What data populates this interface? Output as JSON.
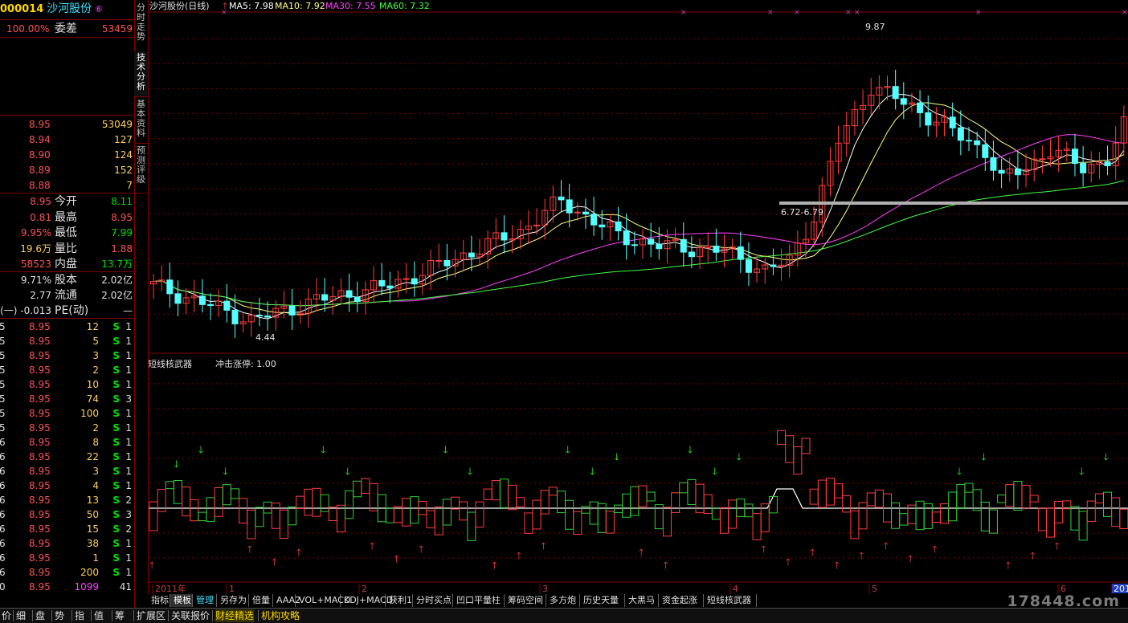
{
  "stock": {
    "code": "000014",
    "name": "沙河股份",
    "badge": "⑥"
  },
  "weibi": {
    "pct": "100.00%",
    "label": "委差",
    "value": "53459"
  },
  "sell_orders": [
    {
      "price": "8.95",
      "vol": "53049"
    },
    {
      "price": "8.94",
      "vol": "127"
    },
    {
      "price": "8.90",
      "vol": "124"
    },
    {
      "price": "8.89",
      "vol": "152"
    },
    {
      "price": "8.88",
      "vol": "7"
    }
  ],
  "quote_rows": [
    {
      "v1": "8.95",
      "label": "今开",
      "v2": "8.11"
    },
    {
      "v1": "0.81",
      "label": "最高",
      "v2": "8.95"
    },
    {
      "v1": "9.95%",
      "label": "最低",
      "v2": "7.99"
    },
    {
      "v1": "19.6万",
      "label": "量比",
      "v2": "1.88"
    },
    {
      "v1": "58523",
      "label": "内盘",
      "v2": "13.7万"
    }
  ],
  "share_rows": [
    {
      "v1": "9.71%",
      "label": "股本",
      "v2": "2.02亿"
    },
    {
      "v1": "2.77",
      "label": "流通",
      "v2": "2.02亿"
    },
    {
      "v1": "(一) -0.013",
      "label": "PE(动)",
      "v2": "—"
    }
  ],
  "ticks": [
    {
      "t": "5",
      "p": "8.95",
      "v": "12",
      "s": "S",
      "n": "1"
    },
    {
      "t": "5",
      "p": "8.95",
      "v": "5",
      "s": "S",
      "n": "1"
    },
    {
      "t": "5",
      "p": "8.95",
      "v": "3",
      "s": "S",
      "n": "1"
    },
    {
      "t": "5",
      "p": "8.95",
      "v": "2",
      "s": "S",
      "n": "1"
    },
    {
      "t": "5",
      "p": "8.95",
      "v": "10",
      "s": "S",
      "n": "1"
    },
    {
      "t": "5",
      "p": "8.95",
      "v": "74",
      "s": "S",
      "n": "3"
    },
    {
      "t": "5",
      "p": "8.95",
      "v": "100",
      "s": "S",
      "n": "1"
    },
    {
      "t": "5",
      "p": "8.95",
      "v": "2",
      "s": "S",
      "n": "1"
    },
    {
      "t": "6",
      "p": "8.95",
      "v": "8",
      "s": "S",
      "n": "1"
    },
    {
      "t": "6",
      "p": "8.95",
      "v": "22",
      "s": "S",
      "n": "1"
    },
    {
      "t": "6",
      "p": "8.95",
      "v": "3",
      "s": "S",
      "n": "1"
    },
    {
      "t": "6",
      "p": "8.95",
      "v": "4",
      "s": "S",
      "n": "1"
    },
    {
      "t": "6",
      "p": "8.95",
      "v": "13",
      "s": "S",
      "n": "2"
    },
    {
      "t": "6",
      "p": "8.95",
      "v": "50",
      "s": "S",
      "n": "3"
    },
    {
      "t": "6",
      "p": "8.95",
      "v": "15",
      "s": "S",
      "n": "2"
    },
    {
      "t": "6",
      "p": "8.95",
      "v": "38",
      "s": "S",
      "n": "1"
    },
    {
      "t": "6",
      "p": "8.95",
      "v": "1",
      "s": "S",
      "n": "1"
    },
    {
      "t": "6",
      "p": "8.95",
      "v": "200",
      "s": "S",
      "n": "1"
    },
    {
      "t": "0",
      "p": "8.95",
      "v": "1099",
      "s": "",
      "n": "41"
    }
  ],
  "vtabs": [
    "分时走势",
    "技术分析",
    "基本资料",
    "预测评级"
  ],
  "main_header": {
    "title": "沙河股份(日线)",
    "ma5": "MA5: 7.98",
    "ma10": "MA10: 7.92",
    "ma30": "MA30: 7.55",
    "ma60": "MA60: 7.32"
  },
  "annotations": {
    "high": "9.87",
    "low": "4.44",
    "range": "6.72-6.79"
  },
  "indicator": {
    "name": "短线核武器",
    "label": "冲击涨停: 1.00"
  },
  "x_labels": [
    "2011年",
    "1",
    "2",
    "3",
    "4",
    "5",
    "6",
    "201"
  ],
  "tabs": [
    "指标",
    "模板",
    "管理",
    "另存为",
    "倍量",
    "AAA2",
    "VOL+MACD",
    "KDJ+MACD",
    "获利1",
    "分时买点",
    "凹口平量柱",
    "筹码空间",
    "多方炮",
    "历史天量",
    "大黑马",
    "资金起涨",
    "短线核武器"
  ],
  "bottom_tabs": [
    "价",
    "细",
    "盘",
    "势",
    "指",
    "值",
    "筹",
    "扩展区",
    "关联报价",
    "财经精选",
    "机构攻略"
  ],
  "watermark": "178448.com",
  "colors": {
    "up": "#ff3c3c",
    "down": "#54ffff",
    "ma5": "#ffffff",
    "ma10": "#ffff80",
    "ma30": "#ff40ff",
    "ma60": "#40ff40",
    "grid": "#800000"
  }
}
